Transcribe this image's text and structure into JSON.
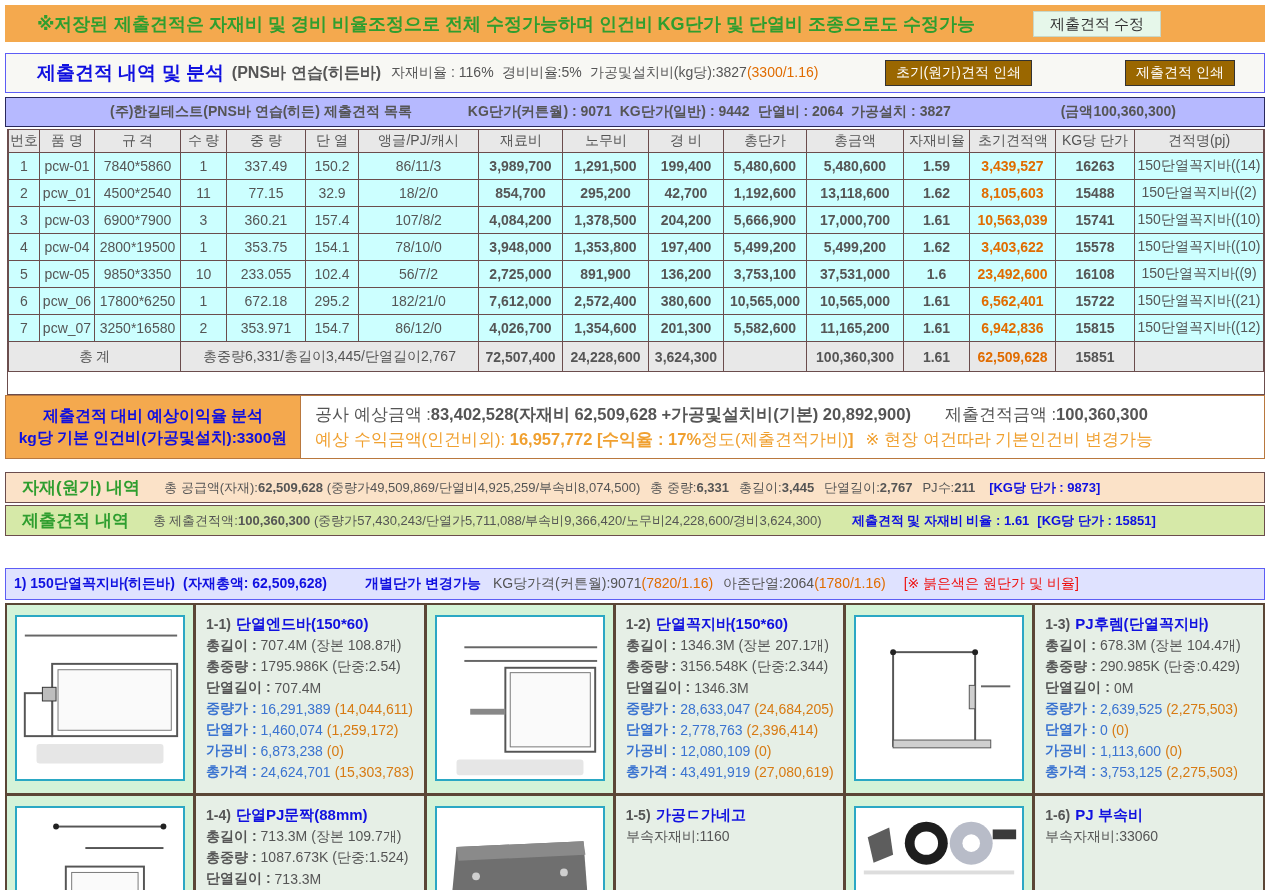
{
  "notice": {
    "text": "※저장된 제출견적은 자재비 및 경비 비율조정으로 전체 수정가능하며 인건비 KG단가 및 단열비 조종으로도 수정가능",
    "button": "제출견적 수정"
  },
  "header": {
    "title": "제출견적 내역 및 분석",
    "subtitle": "(PNS바 연습(히든바)",
    "info": [
      [
        {
          "text": "자재비율 : 116%",
          "kind": "base"
        }
      ],
      [
        {
          "text": "경비비율:5%",
          "kind": "base"
        }
      ],
      [
        {
          "text": "가공및설치비(kg당):3827",
          "kind": "base"
        },
        {
          "text": "(3300/1.16)",
          "kind": "orig"
        }
      ]
    ],
    "buttons": [
      "초기(원가)견적 인쇄",
      "제출견적 인쇄"
    ]
  },
  "company_bar": {
    "items": [
      "(주)한길테스트(PNS바 연습(히든) 제출견적 목록",
      "KG단가(커튼월) : 9071",
      "KG단가(일반) : 9442",
      "단열비 : 2064",
      "가공설치 : 3827",
      "(금액100,360,300)"
    ]
  },
  "table": {
    "columns": [
      "번호",
      "품 명",
      "규 격",
      "수 량",
      "중 량",
      "단 열",
      "앵글/PJ/캐시",
      "재료비",
      "노무비",
      "경 비",
      "총단가",
      "총금액",
      "자재비율",
      "초기견적액",
      "KG당 단가",
      "견적명(pj)"
    ],
    "rows": [
      [
        "1",
        "pcw-01",
        "7840*5860",
        "1",
        "337.49",
        "150.2",
        "86/11/3",
        "3,989,700",
        "1,291,500",
        "199,400",
        "5,480,600",
        "5,480,600",
        "1.59",
        "3,439,527",
        "16263",
        "150단열꼭지바((14)"
      ],
      [
        "2",
        "pcw_01",
        "4500*2540",
        "11",
        "77.15",
        "32.9",
        "18/2/0",
        "854,700",
        "295,200",
        "42,700",
        "1,192,600",
        "13,118,600",
        "1.62",
        "8,105,603",
        "15488",
        "150단열꼭지바((2)"
      ],
      [
        "3",
        "pcw-03",
        "6900*7900",
        "3",
        "360.21",
        "157.4",
        "107/8/2",
        "4,084,200",
        "1,378,500",
        "204,200",
        "5,666,900",
        "17,000,700",
        "1.61",
        "10,563,039",
        "15741",
        "150단열꼭지바((10)"
      ],
      [
        "4",
        "pcw-04",
        "2800*19500",
        "1",
        "353.75",
        "154.1",
        "78/10/0",
        "3,948,000",
        "1,353,800",
        "197,400",
        "5,499,200",
        "5,499,200",
        "1.62",
        "3,403,622",
        "15578",
        "150단열꼭지바((10)"
      ],
      [
        "5",
        "pcw-05",
        "9850*3350",
        "10",
        "233.055",
        "102.4",
        "56/7/2",
        "2,725,000",
        "891,900",
        "136,200",
        "3,753,100",
        "37,531,000",
        "1.6",
        "23,492,600",
        "16108",
        "150단열꼭지바((9)"
      ],
      [
        "6",
        "pcw_06",
        "17800*6250",
        "1",
        "672.18",
        "295.2",
        "182/21/0",
        "7,612,000",
        "2,572,400",
        "380,600",
        "10,565,000",
        "10,565,000",
        "1.61",
        "6,562,401",
        "15722",
        "150단열꼭지바((21)"
      ],
      [
        "7",
        "pcw_07",
        "3250*16580",
        "2",
        "353.971",
        "154.7",
        "86/12/0",
        "4,026,700",
        "1,354,600",
        "201,300",
        "5,582,600",
        "11,165,200",
        "1.61",
        "6,942,836",
        "15815",
        "150단열꼭지바((12)"
      ]
    ],
    "total": {
      "label": "총 계",
      "summary": "총중량6,331/총길이3,445/단열길이2,767",
      "cells": [
        {
          "kind": "value",
          "text": "72,507,400"
        },
        {
          "kind": "value",
          "text": "24,228,600"
        },
        {
          "kind": "value",
          "text": "3,624,300"
        },
        {
          "kind": "blank"
        },
        {
          "kind": "value",
          "text": "100,360,300"
        },
        {
          "kind": "value",
          "text": "1.61"
        },
        {
          "kind": "value",
          "text": "62,509,628"
        },
        {
          "kind": "value",
          "text": "15851"
        },
        {
          "kind": "blank"
        }
      ]
    }
  },
  "analysis": {
    "label_lines": [
      "제출견적 대비 예상이익율 분석",
      "kg당 기본 인건비(가공및설치):3300원"
    ],
    "estimate": "공사 예상금액 :**83,402,528(자재비 62,509,628 +가공및설치비(기본) 20,892,900)**",
    "submitted": "제출견적금액 :**100,360,300**",
    "profit": "예상 수익금액(인건비외): **16,957,772  [수익율 : 17%**정도(제출견적가비)**]**",
    "remark": "※ 현장 여건따라 기본인건비 변경가능"
  },
  "material_summary": {
    "title": "자재(원가) 내역",
    "items": [
      {
        "text": "총 공급액(자재):**62,509,628** (중량가49,509,869/단열비4,925,259/부속비8,074,500)",
        "kind": "plain"
      },
      {
        "text": "총 중량:**6,331**",
        "kind": "plain"
      },
      {
        "text": "총길이:**3,445**",
        "kind": "plain"
      },
      {
        "text": "단열길이:**2,767**",
        "kind": "plain"
      },
      {
        "text": "PJ수:**211**",
        "kind": "plain"
      },
      {
        "text": "**[KG당 단가 : 9873]**",
        "kind": "highlight"
      }
    ]
  },
  "submitted_summary": {
    "title": "제출견적 내역",
    "items": [
      {
        "text": "총 제출견적액:**100,360,300** (중량가57,430,243/단열가5,711,088/부속비9,366,420/노무비24,228,600/경비3,624,300)",
        "kind": "plain"
      },
      {
        "text": "**제출견적 및 자재비 비율 : 1.61**",
        "kind": "highlight"
      },
      {
        "text": "**[KG당 단가 : 15851]**",
        "kind": "highlight"
      }
    ]
  },
  "section": {
    "title": [
      "1) 150단열꼭지바(히든바)",
      "(자재총액: 62,509,628)"
    ],
    "note": "개별단가 변경가능",
    "info": [
      [
        {
          "text": "KG당가격(커튼월):9071",
          "kind": "base"
        },
        {
          "text": "(7820/1.16)",
          "kind": "orig"
        }
      ],
      [
        {
          "text": "아존단열:2064",
          "kind": "base"
        },
        {
          "text": "(1780/1.16)",
          "kind": "orig"
        }
      ]
    ],
    "legend": "[※ 붉은색은 원단가 및 비율]"
  },
  "cards": [
    {
      "number": "1-1)",
      "name": "단열엔드바(150*60)",
      "image": {
        "kind": "picture"
      },
      "lines": [
        {
          "kind": "measure",
          "label": "총길이 :",
          "value": "707.4M (장본 108.8개)"
        },
        {
          "kind": "measure",
          "label": "총중량 :",
          "value": "1795.986K (단중:2.54)"
        },
        {
          "kind": "measure",
          "label": "단열길이 :",
          "value": "707.4M"
        },
        {
          "kind": "price",
          "label": "중량가 :",
          "value": "16,291,389",
          "original": "(14,044,611)"
        },
        {
          "kind": "price",
          "label": "단열가 :",
          "value": "1,460,074",
          "original": "(1,259,172)"
        },
        {
          "kind": "price",
          "label": "가공비 :",
          "value": "6,873,238",
          "original": "(0)"
        },
        {
          "kind": "price",
          "label": "총가격 :",
          "value": "24,624,701",
          "original": "(15,303,783)"
        }
      ]
    },
    {
      "number": "1-2)",
      "name": "단열꼭지바(150*60)",
      "image": {
        "kind": "picture"
      },
      "lines": [
        {
          "kind": "measure",
          "label": "총길이 :",
          "value": "1346.3M (장본 207.1개)"
        },
        {
          "kind": "measure",
          "label": "총중량 :",
          "value": "3156.548K (단중:2.344)"
        },
        {
          "kind": "measure",
          "label": "단열길이 :",
          "value": "1346.3M"
        },
        {
          "kind": "price",
          "label": "중량가 :",
          "value": "28,633,047",
          "original": "(24,684,205)"
        },
        {
          "kind": "price",
          "label": "단열가 :",
          "value": "2,778,763",
          "original": "(2,396,414)"
        },
        {
          "kind": "price",
          "label": "가공비 :",
          "value": "12,080,109",
          "original": "(0)"
        },
        {
          "kind": "price",
          "label": "총가격 :",
          "value": "43,491,919",
          "original": "(27,080,619)"
        }
      ]
    },
    {
      "number": "1-3)",
      "name": "PJ후렘(단열꼭지바)",
      "image": {
        "kind": "picture"
      },
      "lines": [
        {
          "kind": "measure",
          "label": "총길이 :",
          "value": "678.3M (장본 104.4개)"
        },
        {
          "kind": "measure",
          "label": "총중량 :",
          "value": "290.985K (단중:0.429)"
        },
        {
          "kind": "measure",
          "label": "단열길이 :",
          "value": "0M"
        },
        {
          "kind": "price",
          "label": "중량가 :",
          "value": "2,639,525",
          "original": "(2,275,503)"
        },
        {
          "kind": "price",
          "label": "단열가 :",
          "value": "0",
          "original": "(0)"
        },
        {
          "kind": "price",
          "label": "가공비 :",
          "value": "1,113,600",
          "original": "(0)"
        },
        {
          "kind": "price",
          "label": "총가격 :",
          "value": "3,753,125",
          "original": "(2,275,503)"
        }
      ]
    },
    {
      "number": "1-4)",
      "name": "단열PJ문짝(88mm)",
      "image": {
        "kind": "picture"
      },
      "lines": [
        {
          "kind": "measure",
          "label": "총길이 :",
          "value": "713.3M (장본 109.7개)"
        },
        {
          "kind": "measure",
          "label": "총중량 :",
          "value": "1087.673K (단중:1.524)"
        },
        {
          "kind": "measure",
          "label": "단열길이 :",
          "value": "713.3M"
        }
      ]
    },
    {
      "number": "1-5)",
      "name": "가공ㄷ가네고",
      "image": {
        "kind": "picture"
      },
      "lines": [
        {
          "kind": "note",
          "value": "부속자재비:1160"
        }
      ]
    },
    {
      "number": "1-6)",
      "name": "PJ 부속비",
      "image": {
        "kind": "picture"
      },
      "lines": [
        {
          "kind": "note",
          "value": "부속자재비:33060"
        }
      ]
    }
  ]
}
